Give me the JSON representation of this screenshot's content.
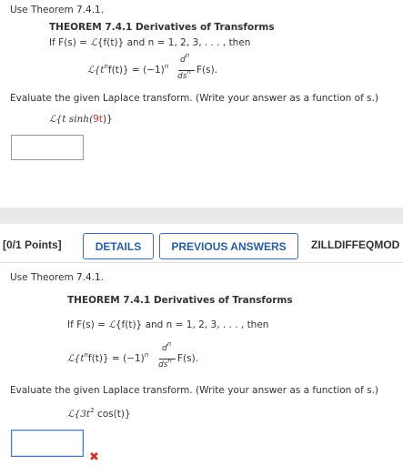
{
  "q1": {
    "intro": "Use Theorem 7.4.1.",
    "theorem_title": "THEOREM 7.4.1  Derivatives of Transforms",
    "theorem_if_prefix": "If F(s) = ",
    "theorem_if_L": "ℒ",
    "theorem_if_mid": "{f(t)} and n = 1, 2, 3, . . . , then",
    "formula_lhs": "ℒ{t",
    "formula_n": "n",
    "formula_mid": "f(t)} = (−1)",
    "formula_dn": "d",
    "formula_dsn": "ds",
    "formula_rhs": "F(s).",
    "instruction": "Evaluate the given Laplace transform. (Write your answer as a function of s.)",
    "expression_prefix": "ℒ{t sinh(",
    "expression_highlight": "9t",
    "expression_suffix": ")}"
  },
  "q2": {
    "score": "[0/1 Points]",
    "details_label": "DETAILS",
    "previous_label": "PREVIOUS ANSWERS",
    "course_code": "ZILLDIFFEQMOD",
    "intro": "Use Theorem 7.4.1.",
    "theorem_title": "THEOREM 7.4.1  Derivatives of Transforms",
    "theorem_if_prefix": "If F(s) = ",
    "theorem_if_L": "ℒ",
    "theorem_if_mid": "{f(t)} and n = 1, 2, 3, . . . , then",
    "formula_lhs": "ℒ{t",
    "formula_n": "n",
    "formula_mid": "f(t)} = (−1)",
    "formula_dn": "d",
    "formula_dsn": "ds",
    "formula_rhs": "F(s).",
    "instruction": "Evaluate the given Laplace transform. (Write your answer as a function of s.)",
    "expression_prefix": "ℒ{3t",
    "expression_sup": "2",
    "expression_suffix": " cos(t)}",
    "status_icon": "x-mark-icon",
    "status_symbol": "✖"
  }
}
